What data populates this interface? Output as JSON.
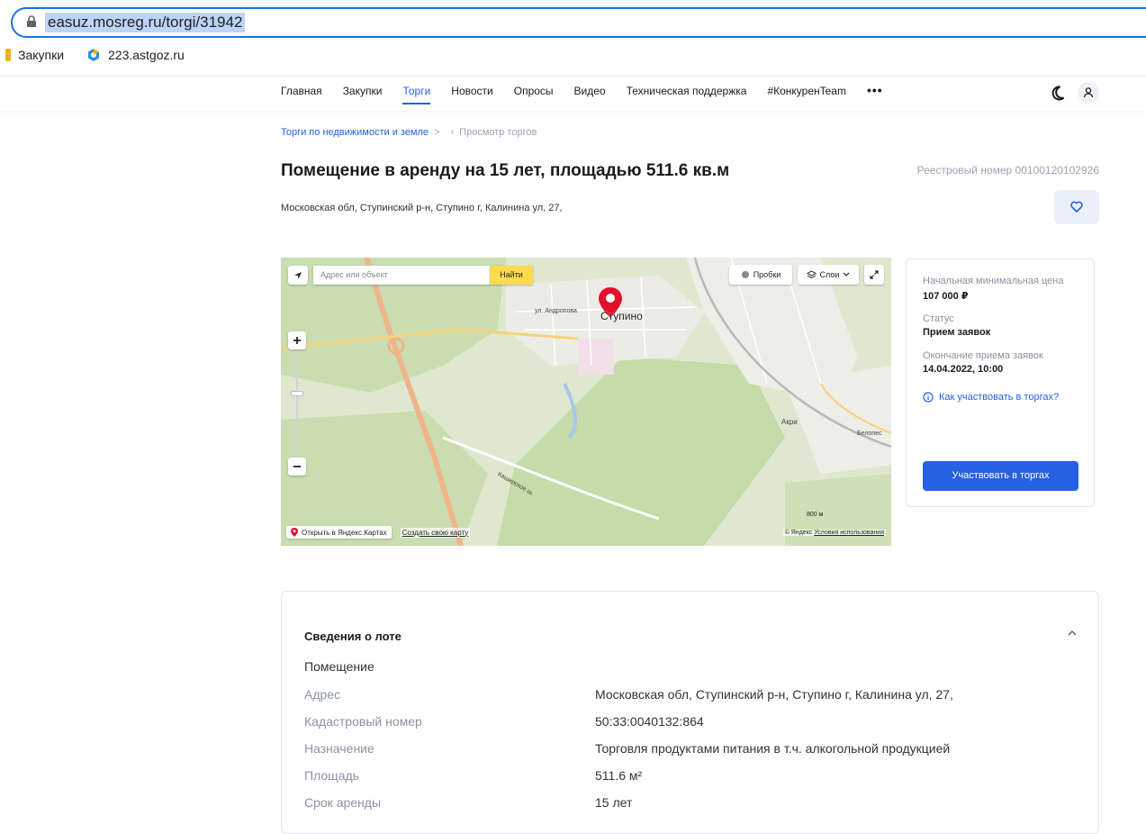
{
  "browser": {
    "url": "easuz.mosreg.ru/torgi/31942",
    "bookmarks": [
      {
        "label": "Закупки",
        "icon": "folder-icon"
      },
      {
        "label": "223.astgoz.ru",
        "icon": "astgoz-logo-icon"
      }
    ]
  },
  "nav": {
    "items": [
      "Главная",
      "Закупки",
      "Торги",
      "Новости",
      "Опросы",
      "Видео",
      "Техническая поддержка",
      "#КонкуренTeam"
    ],
    "active_index": 2,
    "more_label": "•••"
  },
  "breadcrumb": {
    "parent": "Торги по недвижимости и земле",
    "sep": ">",
    "sep2": "›",
    "current": "Просмотр торгов"
  },
  "lot_header": {
    "title": "Помещение в аренду на 15 лет, площадью 511.6 кв.м",
    "registry": "Реестровый номер 00100120102926",
    "address": "Московская обл, Ступинский р-н, Ступино г, Калинина ул, 27,"
  },
  "map": {
    "search_placeholder": "Адрес или объект",
    "find_label": "Найти",
    "traffic_label": "Пробки",
    "layers_label": "Слои",
    "city_label": "Ступино",
    "street_andropova": "ул. Андропова",
    "street_kashirskoe": "Каширское ш.",
    "place_akri": "Акри",
    "place_belopes": "Белопес",
    "open_label": "Открыть в Яндекс.Картах",
    "create_label": "Создать свою карту",
    "copyright": "© Яндекс",
    "terms": "Условия использования",
    "scale": "800 м"
  },
  "card": {
    "price_label": "Начальная минимальная цена",
    "price_value": "107 000 ₽",
    "status_label": "Статус",
    "status_value": "Прием заявок",
    "deadline_label": "Окончание приема заявок",
    "deadline_value": "14.04.2022, 10:00",
    "how_label": "Как участвовать в торгах?",
    "participate_label": "Участвовать в торгах"
  },
  "lot": {
    "heading": "Сведения о лоте",
    "type": "Помещение",
    "rows": [
      {
        "key": "Адрес",
        "value": "Московская обл, Ступинский р-н, Ступино г, Калинина ул, 27,"
      },
      {
        "key": "Кадастровый номер",
        "value": "50:33:0040132:864"
      },
      {
        "key": "Назначение",
        "value": "Торговля продуктами питания в т.ч. алкогольной продукцией"
      },
      {
        "key": "Площадь",
        "value": "511.6 м²"
      },
      {
        "key": "Срок аренды",
        "value": "15 лет"
      }
    ]
  },
  "colors": {
    "accent": "#2660e3",
    "muted": "#8a92a0",
    "map_pin": "#e3102c",
    "find_button": "#ffdb4d"
  }
}
